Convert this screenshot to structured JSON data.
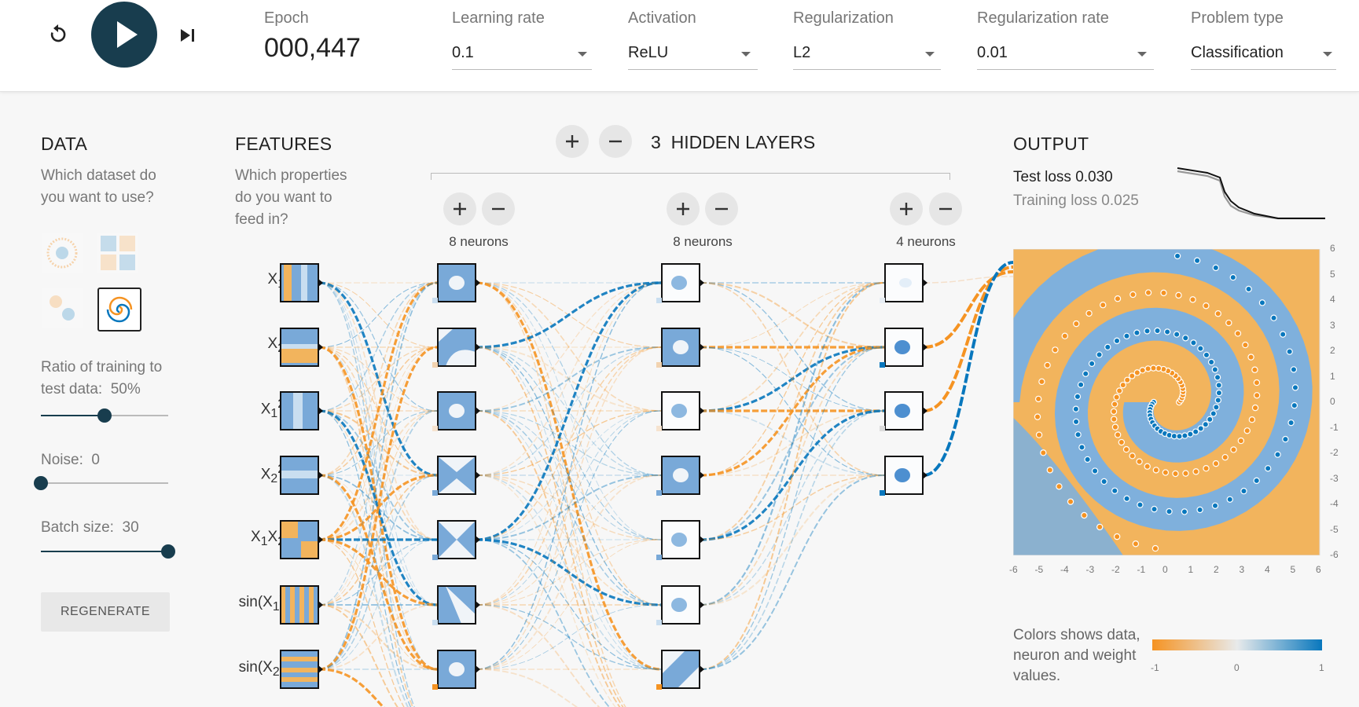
{
  "controls": {
    "reset_icon": "reset-icon",
    "play_icon": "play-icon",
    "step_icon": "step-forward-icon"
  },
  "epoch": {
    "label": "Epoch",
    "value": "000,447"
  },
  "params": [
    {
      "label": "Learning rate",
      "value": "0.1"
    },
    {
      "label": "Activation",
      "value": "ReLU"
    },
    {
      "label": "Regularization",
      "value": "L2"
    },
    {
      "label": "Regularization rate",
      "value": "0.01"
    },
    {
      "label": "Problem type",
      "value": "Classification"
    }
  ],
  "data_panel": {
    "heading": "DATA",
    "question": [
      "Which dataset do",
      "you want to use?"
    ],
    "ratio_label": "Ratio of training to",
    "ratio_label2": "test data:",
    "ratio_value": "50%",
    "ratio_level": 0.5,
    "noise_label": "Noise:",
    "noise_value": "0",
    "noise_level": 0,
    "batch_label": "Batch size:",
    "batch_value": "30",
    "batch_level": 1.0,
    "regenerate": "REGENERATE"
  },
  "features_panel": {
    "heading": "FEATURES",
    "question": [
      "Which properties",
      "do you want to",
      "feed in?"
    ],
    "features": [
      {
        "base": "X",
        "sub": "1",
        "sup": ""
      },
      {
        "base": "X",
        "sub": "2",
        "sup": ""
      },
      {
        "base": "X",
        "sub": "1",
        "sup": "2"
      },
      {
        "base": "X",
        "sub": "2",
        "sup": "2"
      },
      {
        "base": "X",
        "sub": "1",
        "sup": "",
        "base2": "X",
        "sub2": "2"
      },
      {
        "base": "sin(X",
        "sub": "1",
        "sup": "",
        "tail": ")"
      },
      {
        "base": "sin(X",
        "sub": "2",
        "sup": "",
        "tail": ")"
      }
    ]
  },
  "hidden": {
    "count": "3",
    "label": "HIDDEN LAYERS",
    "layers": [
      {
        "neurons": "8 neurons"
      },
      {
        "neurons": "8 neurons"
      },
      {
        "neurons": "4 neurons"
      }
    ]
  },
  "output": {
    "heading": "OUTPUT",
    "test_loss": "Test loss 0.030",
    "training_loss": "Training loss 0.025",
    "x_ticks": [
      "-6",
      "-5",
      "-4",
      "-3",
      "-2",
      "-1",
      "0",
      "1",
      "2",
      "3",
      "4",
      "5",
      "6"
    ],
    "y_ticks": [
      "6",
      "5",
      "4",
      "3",
      "2",
      "1",
      "0",
      "-1",
      "-2",
      "-3",
      "-4",
      "-5",
      "-6"
    ],
    "legend": "Colors shows data, neuron and weight values.",
    "legend_ticks": [
      "-1",
      "0",
      "1"
    ],
    "negative_color": "#f59322",
    "positive_color": "#0877bd"
  }
}
